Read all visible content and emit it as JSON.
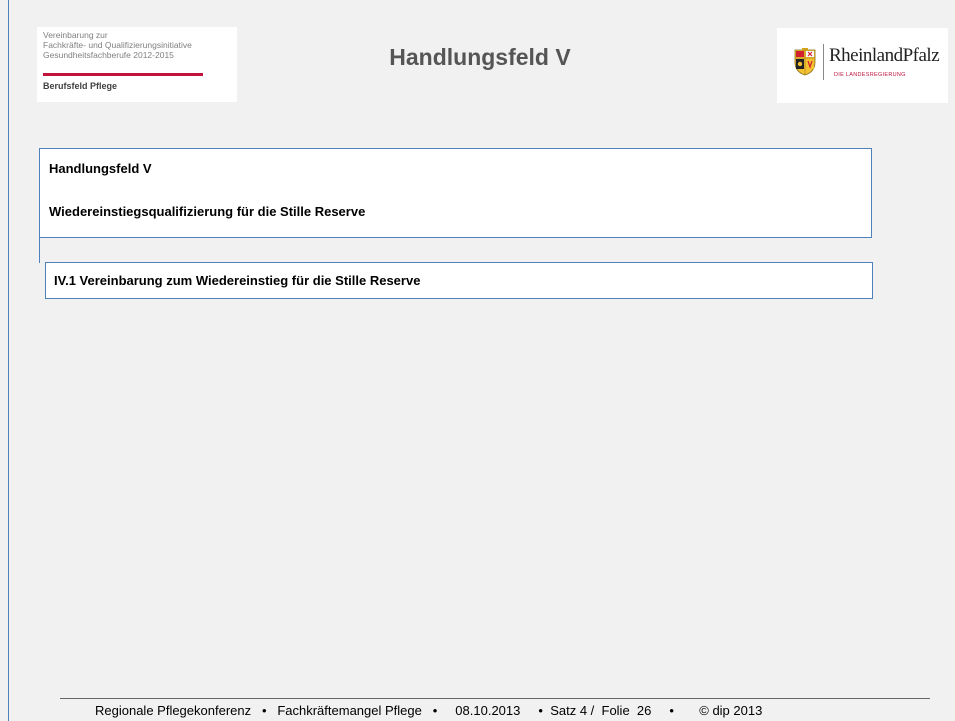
{
  "header": {
    "left_logo": {
      "lines": [
        "Vereinbarung zur",
        "Fachkräfte- und Qualifizierungsinitiative",
        "Gesundheitsfachberufe 2012-2015"
      ],
      "subtitle": "Berufsfeld Pflege"
    },
    "title": "Handlungsfeld V",
    "right_logo": {
      "brand": "RheinlandPfalz",
      "sub": "DIE LANDESREGIERUNG",
      "icon": "coat-of-arms-icon"
    }
  },
  "box1": {
    "line1": "Handlungsfeld V",
    "line2": "Wiedereinstiegsqualifizierung für die Stille Reserve"
  },
  "box2": {
    "text": "IV.1 Vereinbarung zum Wiedereinstieg für die Stille Reserve"
  },
  "footer": {
    "text": "Regionale Pflegekonferenz   •   Fachkräftemangel Pflege   •     08.10.2013     •  Satz 4 /  Folie  26     •       © dip 2013"
  },
  "colors": {
    "accent_blue": "#4f81bd",
    "brand_red": "#c0143c",
    "background": "#f1f1f1"
  }
}
